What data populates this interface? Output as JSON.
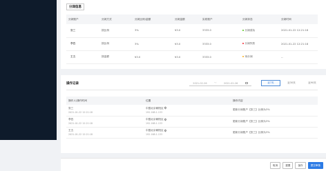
{
  "allocation": {
    "title": "分润信息",
    "columns": [
      "分润账户",
      "分润方式",
      "分润比例/金额",
      "分润金额",
      "实收账户",
      "分润状态",
      "分润时间"
    ],
    "rows": [
      {
        "account": "张三",
        "method": "按比例",
        "ratio": "3%",
        "amount": "¥3.0",
        "receiver": "3333.0",
        "status": "分润成功",
        "status_color": "#52c41a",
        "time": "2021-01-22 12:21:18"
      },
      {
        "account": "李四",
        "method": "按比例",
        "ratio": "3%",
        "amount": "¥3.0",
        "receiver": "3333.0",
        "status": "分润失败",
        "status_color": "#f5222d",
        "time": "2021-01-22 12:21:18"
      },
      {
        "account": "王五",
        "method": "按金额",
        "ratio": "¥3.0",
        "amount": "¥3.0",
        "receiver": "3333.0",
        "status": "待分润",
        "status_color": "#faad14",
        "time": "--"
      }
    ]
  },
  "oplog": {
    "title": "操作记录",
    "date_start": "2021-02-26",
    "date_sep": "～",
    "date_end": "2021-02-26",
    "tabs": [
      "近7天",
      "近30天",
      "近90天"
    ],
    "active_tab": 0,
    "columns": [
      "操作人/操作时间",
      "位置",
      "操作内容"
    ],
    "rows": [
      {
        "user": "张三",
        "time": "2021-01-22 12:21:18",
        "location": "中国北京朝阳区",
        "ip": "192.168.1.133",
        "content": "更新分润账户【张三】比例为3%"
      },
      {
        "user": "李四",
        "time": "2021-01-22 12:21:18",
        "location": "中国北京朝阳区",
        "ip": "192.168.1.133",
        "content": "更新分润账户【张三】比例为3%"
      },
      {
        "user": "王五",
        "time": "2021-01-22 12:21:18",
        "location": "中国北京朝阳区",
        "ip": "192.168.1.133",
        "content": "更新分润账户【张三】比例为3%"
      }
    ]
  },
  "footer": {
    "buttons": [
      "取消",
      "重置",
      "保存",
      "提交审核"
    ]
  },
  "colors": {
    "sidebar": "#0e1b2b",
    "primary": "#2c7be5"
  }
}
